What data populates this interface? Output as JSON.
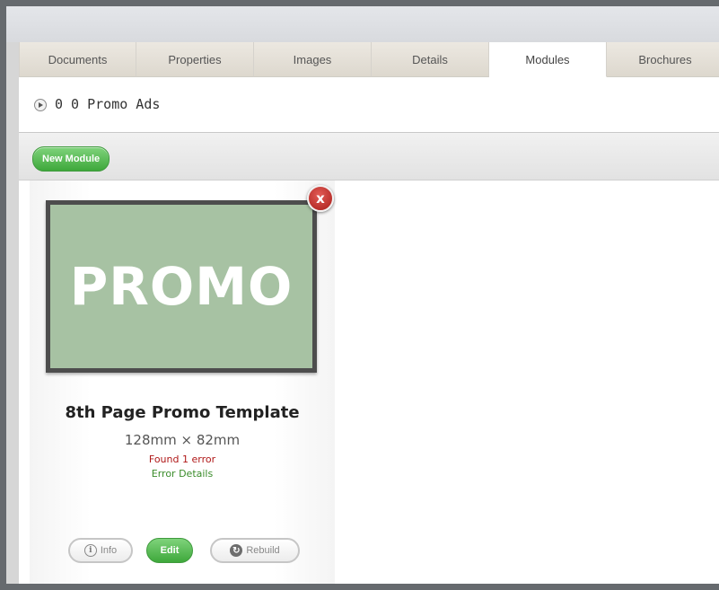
{
  "tabs": [
    {
      "label": "Documents"
    },
    {
      "label": "Properties"
    },
    {
      "label": "Images"
    },
    {
      "label": "Details"
    },
    {
      "label": "Modules",
      "active": true
    },
    {
      "label": "Brochures"
    }
  ],
  "breadcrumb": {
    "text": "0 0 Promo Ads",
    "icon": "play-circle-icon"
  },
  "toolbar": {
    "new_module_label": "New Module"
  },
  "module": {
    "thumbnail_text": "PROMO",
    "thumbnail_color": "#a7c2a3",
    "close_label": "x",
    "name": "8th Page Promo Template",
    "dimensions": "128mm × 82mm",
    "error_text": "Found 1 error",
    "error_link": "Error Details",
    "actions": {
      "info_label": "Info",
      "info_icon": "info-icon",
      "edit_label": "Edit",
      "rebuild_label": "Rebuild",
      "rebuild_icon": "refresh-icon"
    }
  },
  "colors": {
    "accent_green": "#3ea83b",
    "error_red": "#b01818",
    "close_red": "#c0302b"
  }
}
